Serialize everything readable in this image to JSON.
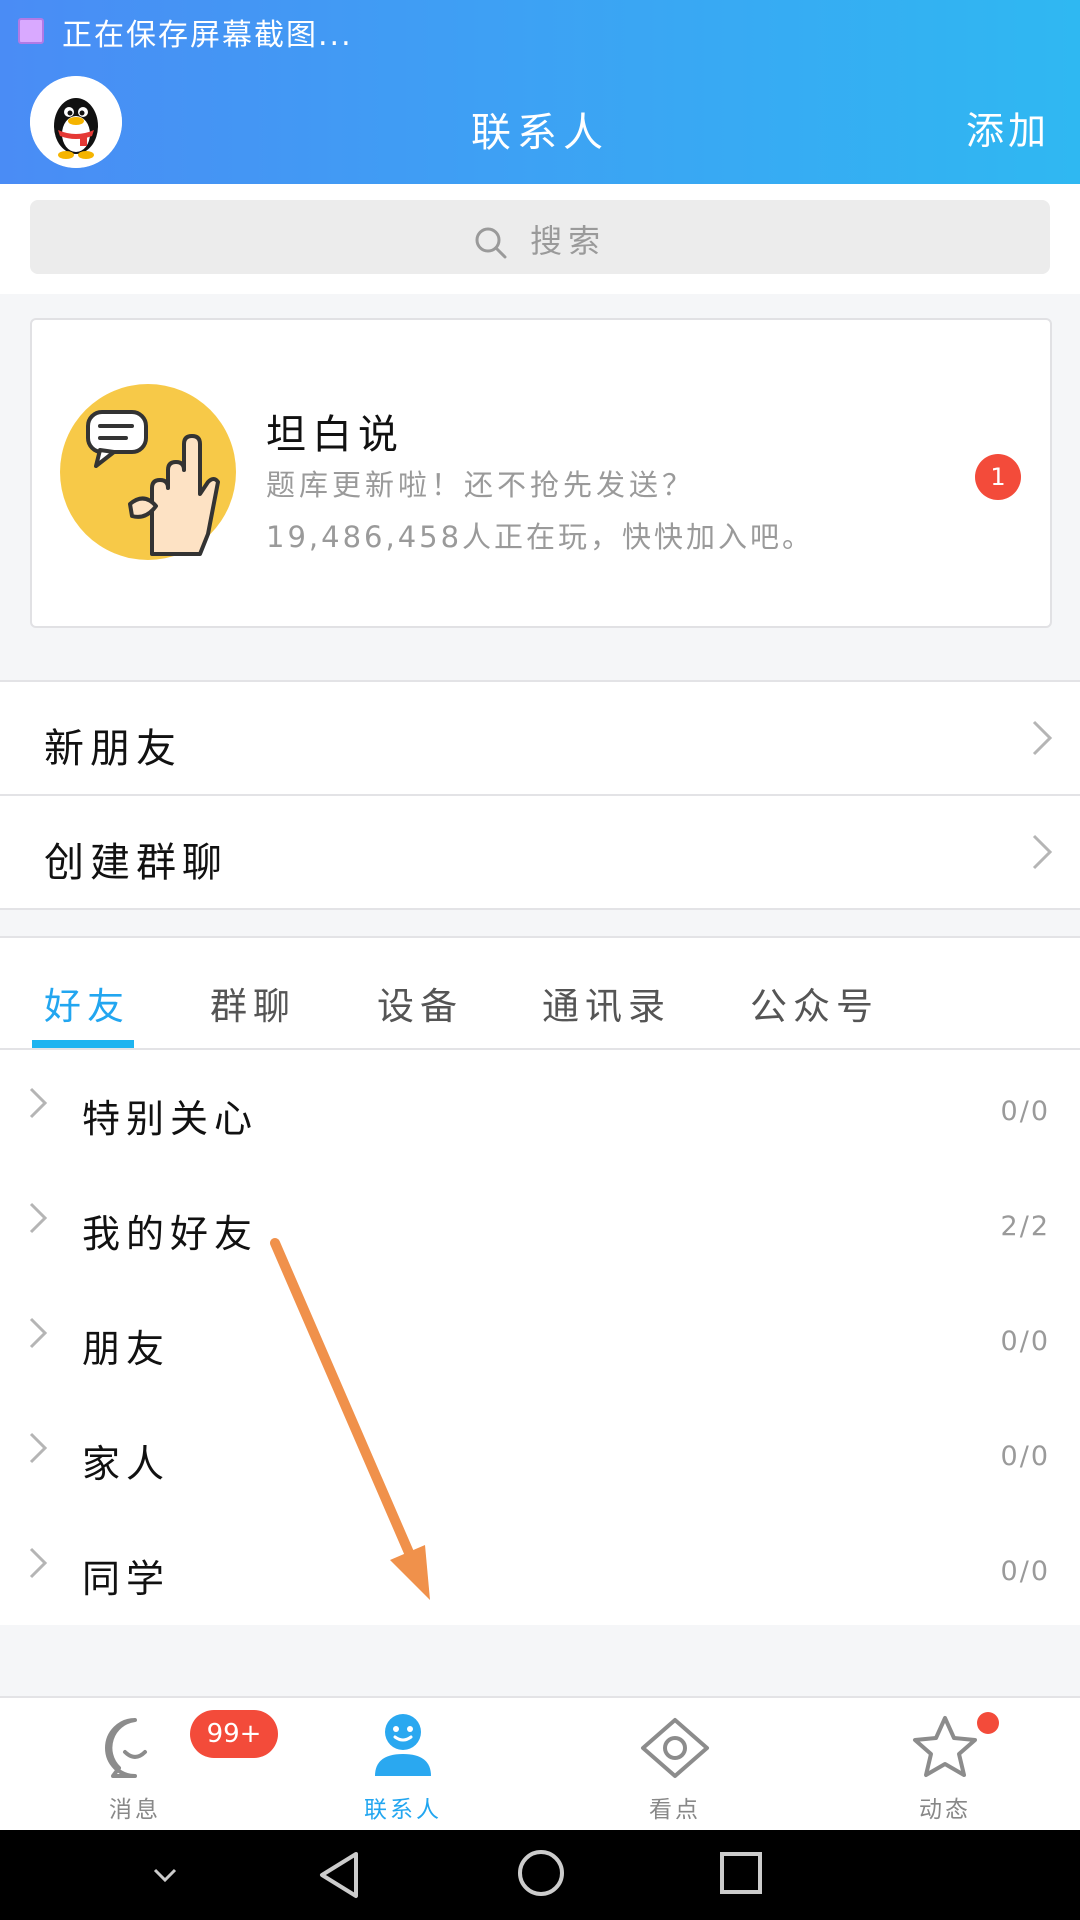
{
  "status_bar": {
    "text": "正在保存屏幕截图..."
  },
  "header": {
    "title": "联系人",
    "add_label": "添加"
  },
  "search": {
    "placeholder": "搜索"
  },
  "card": {
    "title": "坦白说",
    "line1": "题库更新啦！还不抢先发送？",
    "line2": "19,486,458人正在玩，快快加入吧。",
    "badge": "1"
  },
  "menu": [
    {
      "label": "新朋友"
    },
    {
      "label": "创建群聊"
    }
  ],
  "tabs": [
    {
      "label": "好友",
      "active": true
    },
    {
      "label": "群聊"
    },
    {
      "label": "设备"
    },
    {
      "label": "通讯录"
    },
    {
      "label": "公众号"
    }
  ],
  "groups": [
    {
      "label": "特别关心",
      "count": "0/0"
    },
    {
      "label": "我的好友",
      "count": "2/2"
    },
    {
      "label": "朋友",
      "count": "0/0"
    },
    {
      "label": "家人",
      "count": "0/0"
    },
    {
      "label": "同学",
      "count": "0/0"
    }
  ],
  "bottom_nav": [
    {
      "label": "消息",
      "badge": "99+",
      "icon": "message-icon"
    },
    {
      "label": "联系人",
      "icon": "contacts-icon",
      "active": true
    },
    {
      "label": "看点",
      "icon": "eye-icon"
    },
    {
      "label": "动态",
      "icon": "star-icon"
    }
  ],
  "colors": {
    "header_start": "#4a8cf5",
    "header_end": "#2fb8f2",
    "accent": "#22a6f0",
    "badge_red": "#f34b3a",
    "annotation_arrow": "#f0914b"
  }
}
